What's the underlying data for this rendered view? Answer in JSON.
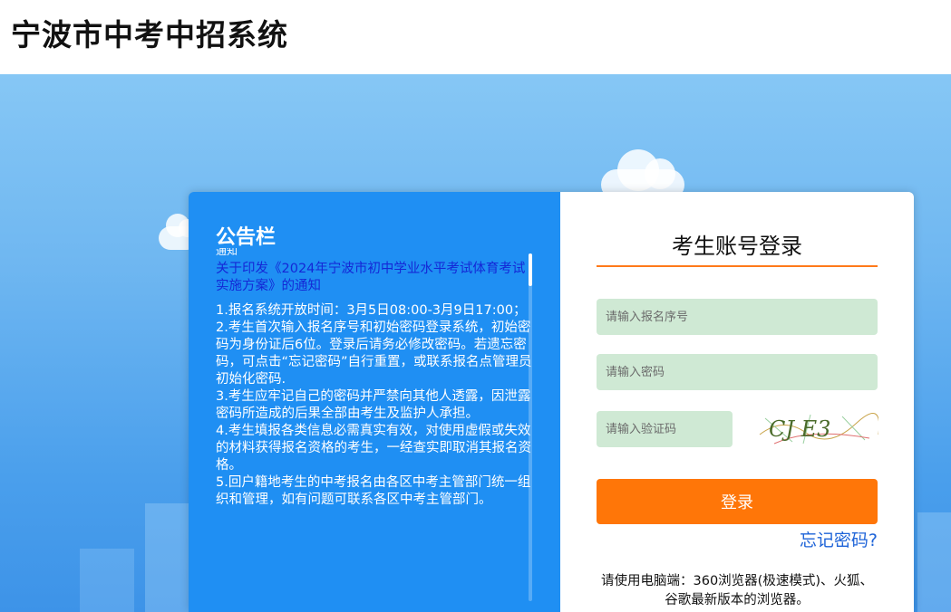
{
  "site": {
    "title": "宁波市中考中招系统"
  },
  "notice": {
    "title": "公告栏",
    "subtitle": "通知",
    "link": "关于印发《2024年宁波市初中学业水平考试体育考试实施方案》的通知",
    "content": "1.报名系统开放时间：3月5日08:00-3月9日17:00；\n2.考生首次输入报名序号和初始密码登录系统，初始密码为身份证后6位。登录后请务必修改密码。若遗忘密码，可点击“忘记密码”自行重置，或联系报名点管理员初始化密码.\n3.考生应牢记自己的密码并严禁向其他人透露，因泄露密码所造成的后果全部由考生及监护人承担。\n4.考生填报各类信息必需真实有效，对使用虚假或失效的材料获得报名资格的考生，一经查实即取消其报名资格。\n5.回户籍地考生的中考报名由各区中考主管部门统一组织和管理，如有问题可联系各区中考主管部门。"
  },
  "login": {
    "title": "考生账号登录",
    "username_placeholder": "请输入报名序号",
    "password_placeholder": "请输入密码",
    "captcha_placeholder": "请输入验证码",
    "captcha_text": "CJ E3",
    "submit_label": "登录",
    "forgot_label": "忘记密码?",
    "browser_tip": "请使用电脑端：360浏览器(极速模式)、火狐、谷歌最新版本的浏览器。"
  },
  "colors": {
    "notice_bg": "#1f8ff3",
    "accent": "#ff7608",
    "input_bg": "#cfe9d4",
    "link": "#1d63d8"
  }
}
